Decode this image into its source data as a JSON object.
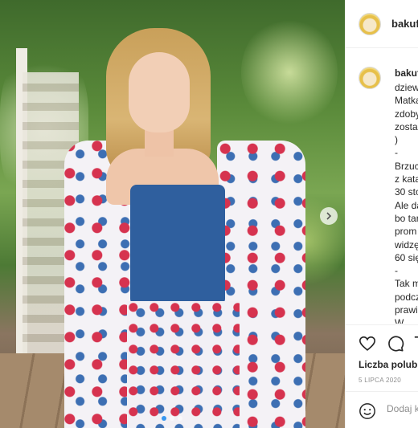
{
  "post": {
    "username": "bakuf",
    "image_alt": "",
    "carousel": {
      "slides": 3,
      "active": 0
    }
  },
  "caption": {
    "username": "bakuf",
    "lines": [
      "dziew",
      "Matka",
      "zdoby",
      "zosta",
      ")",
      "-",
      "Brzuc",
      "z kata",
      "30 sto",
      "Ale da",
      "bo tar",
      "prom",
      "widzę",
      "60 się",
      "-",
      "Tak m",
      "podcz",
      "prawi",
      "W"
    ]
  },
  "actions": {
    "likes_label": "Liczba polubi",
    "date": "5 LIPCA 2020",
    "comment_placeholder": "Dodaj k"
  },
  "colors": {
    "accent": "#3897f0",
    "text": "#262626",
    "muted": "#8e8e8e",
    "border": "#efefef"
  },
  "icons": [
    "next-arrow-icon",
    "heart-icon",
    "comment-icon",
    "share-icon",
    "smiley-icon",
    "avatar-icon"
  ]
}
